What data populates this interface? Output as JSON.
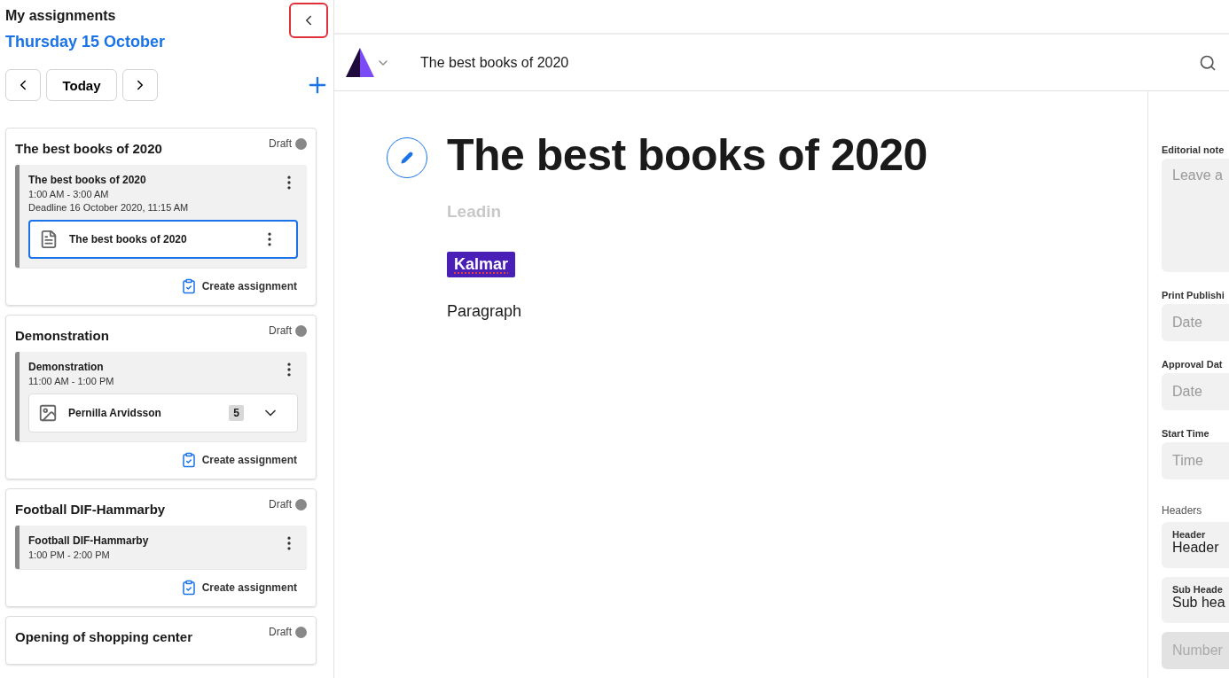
{
  "sidebar": {
    "title": "My assignments",
    "date": "Thursday 15 October",
    "today_button": "Today",
    "cards": [
      {
        "title": "The best books of 2020",
        "status": "Draft",
        "action": "Create assignment",
        "slots": [
          {
            "title": "The best books of 2020",
            "time": "1:00 AM - 3:00 AM",
            "deadline": "Deadline 16 October 2020, 11:15 AM",
            "items": [
              {
                "kind": "article",
                "name": "The best books of 2020",
                "selected": true
              }
            ]
          }
        ]
      },
      {
        "title": "Demonstration",
        "status": "Draft",
        "action": "Create assignment",
        "slots": [
          {
            "title": "Demonstration",
            "time": "11:00 AM - 1:00 PM",
            "items": [
              {
                "kind": "image",
                "name": "Pernilla Arvidsson",
                "count": "5",
                "selected": false
              }
            ]
          }
        ]
      },
      {
        "title": "Football DIF-Hammarby",
        "status": "Draft",
        "action": "Create assignment",
        "slots": [
          {
            "title": "Football DIF-Hammarby",
            "time": "1:00 PM - 2:00 PM"
          }
        ]
      },
      {
        "title": "Opening of shopping center",
        "status": "Draft"
      }
    ]
  },
  "toolbar": {
    "document_title": "The best books of 2020"
  },
  "editor": {
    "title": "The best books of 2020",
    "leadin": "Leadin",
    "tag": "Kalmar",
    "paragraph": "Paragraph"
  },
  "right_panel": {
    "fields": [
      {
        "kind": "textarea",
        "label": "Editorial note",
        "placeholder": "Leave a"
      },
      {
        "kind": "input",
        "label": "Print Publishi",
        "placeholder": "Date",
        "disabled": false
      },
      {
        "kind": "input",
        "label": "Approval Dat",
        "placeholder": "Date",
        "disabled": false
      },
      {
        "kind": "input",
        "label": "Start Time",
        "placeholder": "Time",
        "disabled": false
      },
      {
        "kind": "heading",
        "label": "Headers"
      },
      {
        "kind": "floating",
        "label": "Header",
        "value": "Header"
      },
      {
        "kind": "floating",
        "label": "Sub Heade",
        "value": "Sub hea"
      },
      {
        "kind": "input",
        "placeholder": "Number",
        "disabled": true
      }
    ]
  }
}
